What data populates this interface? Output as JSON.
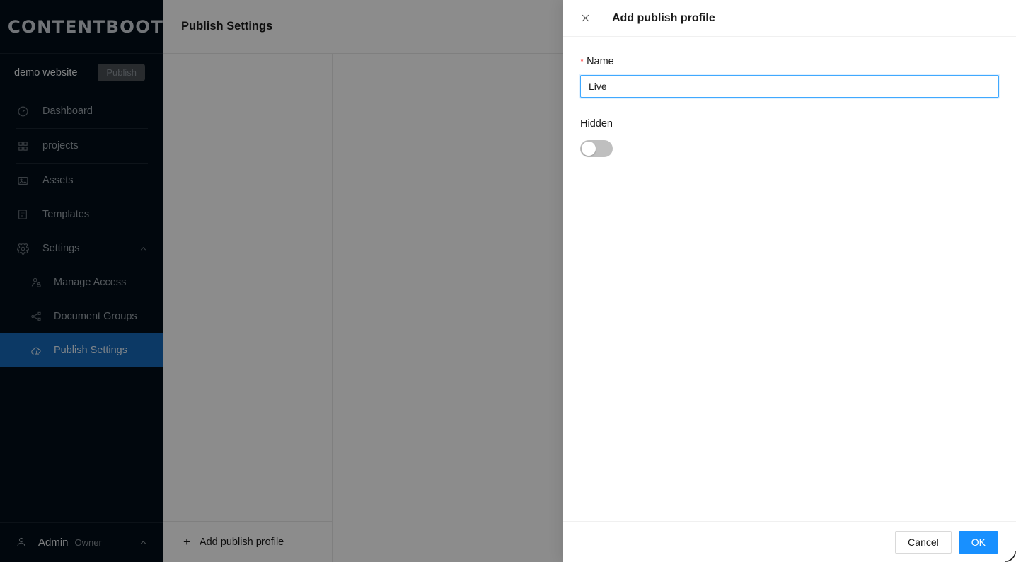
{
  "sidebar": {
    "logo": "CONTENTBOOT",
    "site": {
      "name": "demo website",
      "publish_label": "Publish"
    },
    "nav": [
      {
        "label": "Dashboard",
        "icon": "gauge-icon"
      },
      {
        "label": "projects",
        "icon": "grid-icon"
      },
      {
        "label": "Assets",
        "icon": "image-icon"
      },
      {
        "label": "Templates",
        "icon": "template-icon"
      },
      {
        "label": "Settings",
        "icon": "gear-icon",
        "chevron": "chevron-up-icon"
      }
    ],
    "sub_items": [
      {
        "label": "Manage Access",
        "icon": "user-lock-icon",
        "active": false
      },
      {
        "label": "Document Groups",
        "icon": "sitemap-icon",
        "active": false
      },
      {
        "label": "Publish Settings",
        "icon": "cloud-publish-icon",
        "active": true
      }
    ],
    "footer": {
      "user": "Admin",
      "role": "Owner",
      "chevron": "chevron-up-icon"
    }
  },
  "main": {
    "page_title": "Publish Settings",
    "add_profile_label": "Add publish profile",
    "add_profile_plus": "+"
  },
  "drawer": {
    "title": "Add publish profile",
    "close_icon": "close-icon",
    "name_field": {
      "label": "Name",
      "required_marker": "*",
      "value": "Live",
      "placeholder": ""
    },
    "hidden_field": {
      "label": "Hidden",
      "enabled": false
    },
    "footer": {
      "cancel_label": "Cancel",
      "ok_label": "OK"
    }
  },
  "colors": {
    "sidebar_bg": "#030e18",
    "active_item": "#1668b8",
    "primary": "#1890ff",
    "focus_border": "#40a9ff",
    "required_star": "#ff4d4f",
    "mask": "rgba(0,0,0,0.45)"
  }
}
